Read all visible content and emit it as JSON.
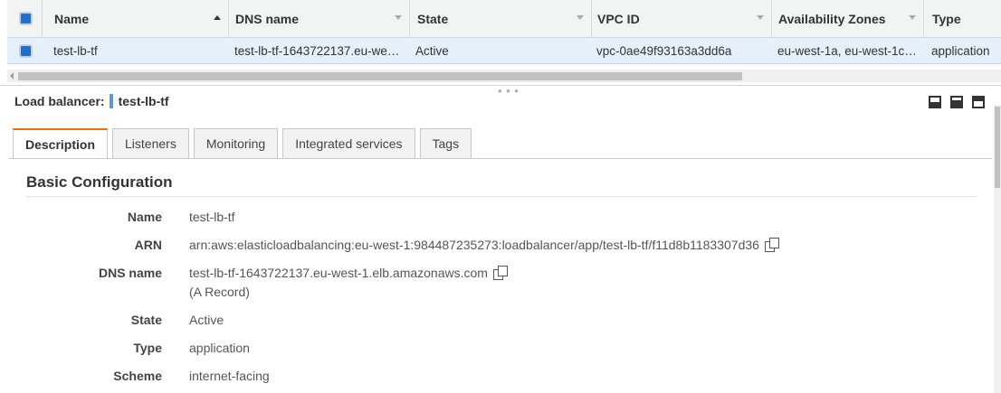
{
  "table": {
    "columns": [
      {
        "label": "Name"
      },
      {
        "label": "DNS name"
      },
      {
        "label": "State"
      },
      {
        "label": "VPC ID"
      },
      {
        "label": "Availability Zones"
      },
      {
        "label": "Type"
      }
    ],
    "rows": [
      {
        "name": "test-lb-tf",
        "dns": "test-lb-tf-1643722137.eu-we…",
        "state": "Active",
        "vpc": "vpc-0ae49f93163a3dd6a",
        "zones": "eu-west-1a, eu-west-1c…",
        "type": "application"
      }
    ]
  },
  "detail": {
    "title_label": "Load balancer:",
    "title_value": "test-lb-tf",
    "tabs": [
      "Description",
      "Listeners",
      "Monitoring",
      "Integrated services",
      "Tags"
    ],
    "active_tab": "Description",
    "section_title": "Basic Configuration",
    "fields": {
      "name": {
        "label": "Name",
        "value": "test-lb-tf"
      },
      "arn": {
        "label": "ARN",
        "value": "arn:aws:elasticloadbalancing:eu-west-1:984487235273:loadbalancer/app/test-lb-tf/f11d8b1183307d36"
      },
      "dns": {
        "label": "DNS name",
        "value": "test-lb-tf-1643722137.eu-west-1.elb.amazonaws.com",
        "note": "(A Record)"
      },
      "state": {
        "label": "State",
        "value": "Active"
      },
      "type": {
        "label": "Type",
        "value": "application"
      },
      "scheme": {
        "label": "Scheme",
        "value": "internet-facing"
      }
    }
  },
  "icons": {
    "copy": "copy-icon",
    "layout": [
      "layout-bottom-icon",
      "layout-split-icon",
      "layout-top-icon"
    ]
  },
  "colors": {
    "accent_tab": "#ec7211",
    "selected_row": "#e6f0fa",
    "checkbox": "#1f6fd0"
  }
}
